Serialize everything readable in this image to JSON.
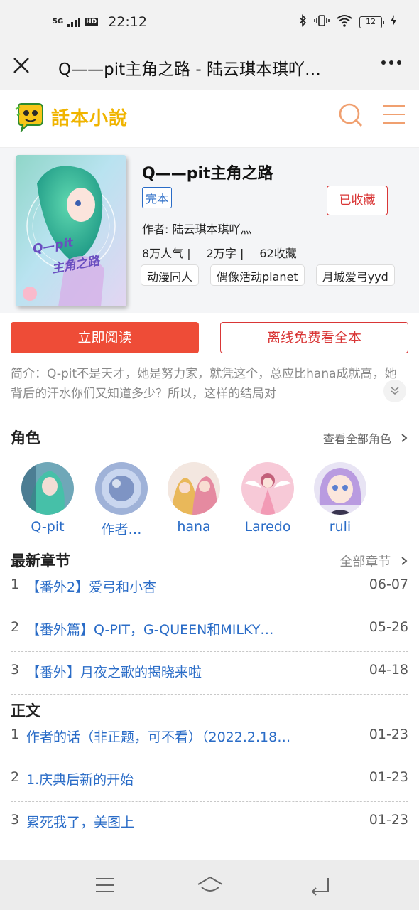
{
  "status_bar": {
    "network": "5G",
    "hd": "HD",
    "time": "22:12",
    "battery": "12"
  },
  "title_bar": {
    "title": "Q——pit主角之路 - 陆云琪本琪吖…"
  },
  "site": {
    "logo_text": "話本小說"
  },
  "book": {
    "title": "Q——pit主角之路",
    "status": "完本",
    "collect_label": "已收藏",
    "author_line": "作者: 陆云琪本琪吖灬",
    "stats": [
      "8万人气 |",
      "2万字 |",
      "62收藏"
    ],
    "tags": [
      "动漫同人",
      "偶像活动planet",
      "月城爱弓yyd"
    ],
    "cover_text": [
      "Q—pit",
      "主角之路"
    ]
  },
  "actions": {
    "read": "立即阅读",
    "offline": "离线免费看全本"
  },
  "intro": "简介：Q-pit不是天才，她是努力家，就凭这个，总应比hana成就高，她背后的汗水你们又知道多少？所以，这样的结局对",
  "roles": {
    "heading": "角色",
    "view_all": "查看全部角色",
    "items": [
      {
        "name": "Q-pit"
      },
      {
        "name": "作者…"
      },
      {
        "name": "hana"
      },
      {
        "name": "Laredo"
      },
      {
        "name": "ruli"
      }
    ]
  },
  "latest": {
    "heading": "最新章节",
    "all_label": "全部章节",
    "items": [
      {
        "no": "1",
        "title": "【番外2】爱弓和小杏",
        "date": "06-07"
      },
      {
        "no": "2",
        "title": "【番外篇】Q-PIT，G-QUEEN和MILKY…",
        "date": "05-26"
      },
      {
        "no": "3",
        "title": "【番外】月夜之歌的揭晓来啦",
        "date": "04-18"
      }
    ]
  },
  "main_text": {
    "heading": "正文",
    "items": [
      {
        "no": "1",
        "title": "作者的话（非正题，可不看）（2022.2.18…",
        "date": "01-23"
      },
      {
        "no": "2",
        "title": "1.庆典后新的开始",
        "date": "01-23"
      },
      {
        "no": "3",
        "title": "累死我了，美图上",
        "date": "01-23"
      }
    ]
  },
  "colors": {
    "accent": "#ee4c37",
    "link": "#2a6cc7",
    "logo": "#f0b400",
    "icon": "#f0a070"
  }
}
